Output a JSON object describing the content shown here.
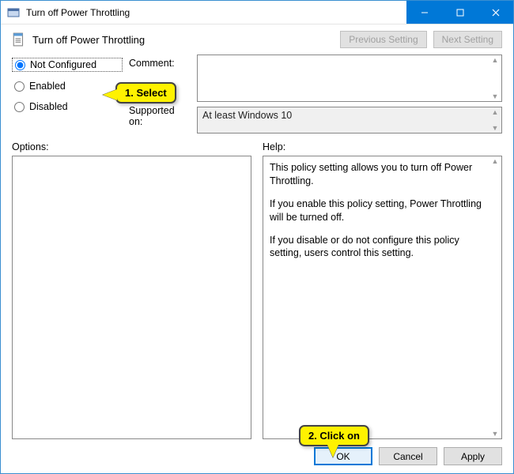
{
  "titlebar": {
    "title": "Turn off Power Throttling"
  },
  "header": {
    "policy_name": "Turn off Power Throttling",
    "prev_btn": "Previous Setting",
    "next_btn": "Next Setting"
  },
  "radios": {
    "not_configured": "Not Configured",
    "enabled": "Enabled",
    "disabled": "Disabled",
    "selected": "not_configured"
  },
  "labels": {
    "comment": "Comment:",
    "supported": "Supported on:",
    "options": "Options:",
    "help": "Help:"
  },
  "fields": {
    "comment_value": "",
    "supported_value": "At least Windows 10"
  },
  "help_text": {
    "p1": "This policy setting allows you to turn off Power Throttling.",
    "p2": "If you enable this policy setting, Power Throttling will be turned off.",
    "p3": "If you disable or do not configure this policy setting, users control this setting."
  },
  "footer": {
    "ok": "OK",
    "cancel": "Cancel",
    "apply": "Apply"
  },
  "callouts": {
    "c1": "1. Select",
    "c2": "2. Click on"
  }
}
